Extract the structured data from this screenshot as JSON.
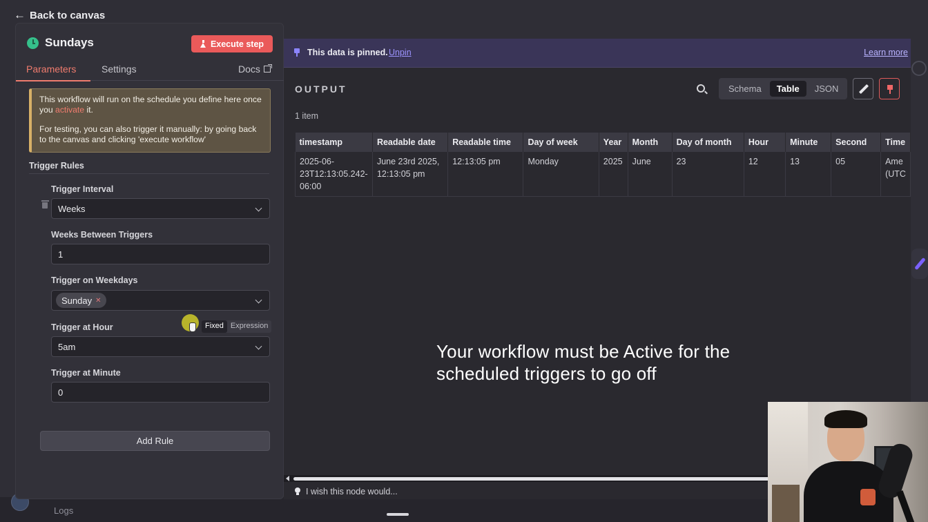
{
  "nav": {
    "back_label": "Back to canvas"
  },
  "node": {
    "title": "Sundays",
    "execute_label": "Execute step",
    "tabs": {
      "parameters": "Parameters",
      "settings": "Settings",
      "docs": "Docs"
    }
  },
  "info": {
    "line1_pre": "This workflow will run on the schedule you define here once you ",
    "line1_link": "activate",
    "line1_post": " it.",
    "line2": "For testing, you can also trigger it manually: by going back to the canvas and clicking 'execute workflow'"
  },
  "rules": {
    "section_title": "Trigger Rules",
    "trigger_interval": {
      "label": "Trigger Interval",
      "value": "Weeks"
    },
    "weeks_between": {
      "label": "Weeks Between Triggers",
      "value": "1"
    },
    "weekdays": {
      "label": "Trigger on Weekdays",
      "chip": "Sunday"
    },
    "hour": {
      "label": "Trigger at Hour",
      "value": "5am",
      "mode_fixed": "Fixed",
      "mode_expression": "Expression"
    },
    "minute": {
      "label": "Trigger at Minute",
      "value": "0"
    },
    "add_rule_label": "Add Rule"
  },
  "output": {
    "pin_text": "This data is pinned.",
    "unpin_label": "Unpin",
    "learn_more_label": "Learn more",
    "title": "OUTPUT",
    "views": {
      "schema": "Schema",
      "table": "Table",
      "json": "JSON"
    },
    "items_count": "1 item",
    "columns": [
      "timestamp",
      "Readable date",
      "Readable time",
      "Day of week",
      "Year",
      "Month",
      "Day of month",
      "Hour",
      "Minute",
      "Second",
      "Time"
    ],
    "row": [
      "2025-06-23T12:13:05.242-06:00",
      "June 23rd 2025, 12:13:05 pm",
      "12:13:05 pm",
      "Monday",
      "2025",
      "June",
      "23",
      "12",
      "13",
      "05",
      "Ame (UTC"
    ]
  },
  "caption": {
    "line1": "Your workflow must be Active for the",
    "line2": "scheduled triggers to go off"
  },
  "footer": {
    "wish_text": "I wish this node would...",
    "logs_label": "Logs"
  },
  "colors": {
    "accent_red": "#ea5a5a",
    "pin_purple": "#8c85ff",
    "tab_active": "#f07c6e"
  },
  "icons": [
    "arrow-left-icon",
    "clock-icon",
    "flask-icon",
    "external-link-icon",
    "trash-icon",
    "chevron-down-icon",
    "pin-icon",
    "search-icon",
    "pencil-icon",
    "lightbulb-icon"
  ]
}
